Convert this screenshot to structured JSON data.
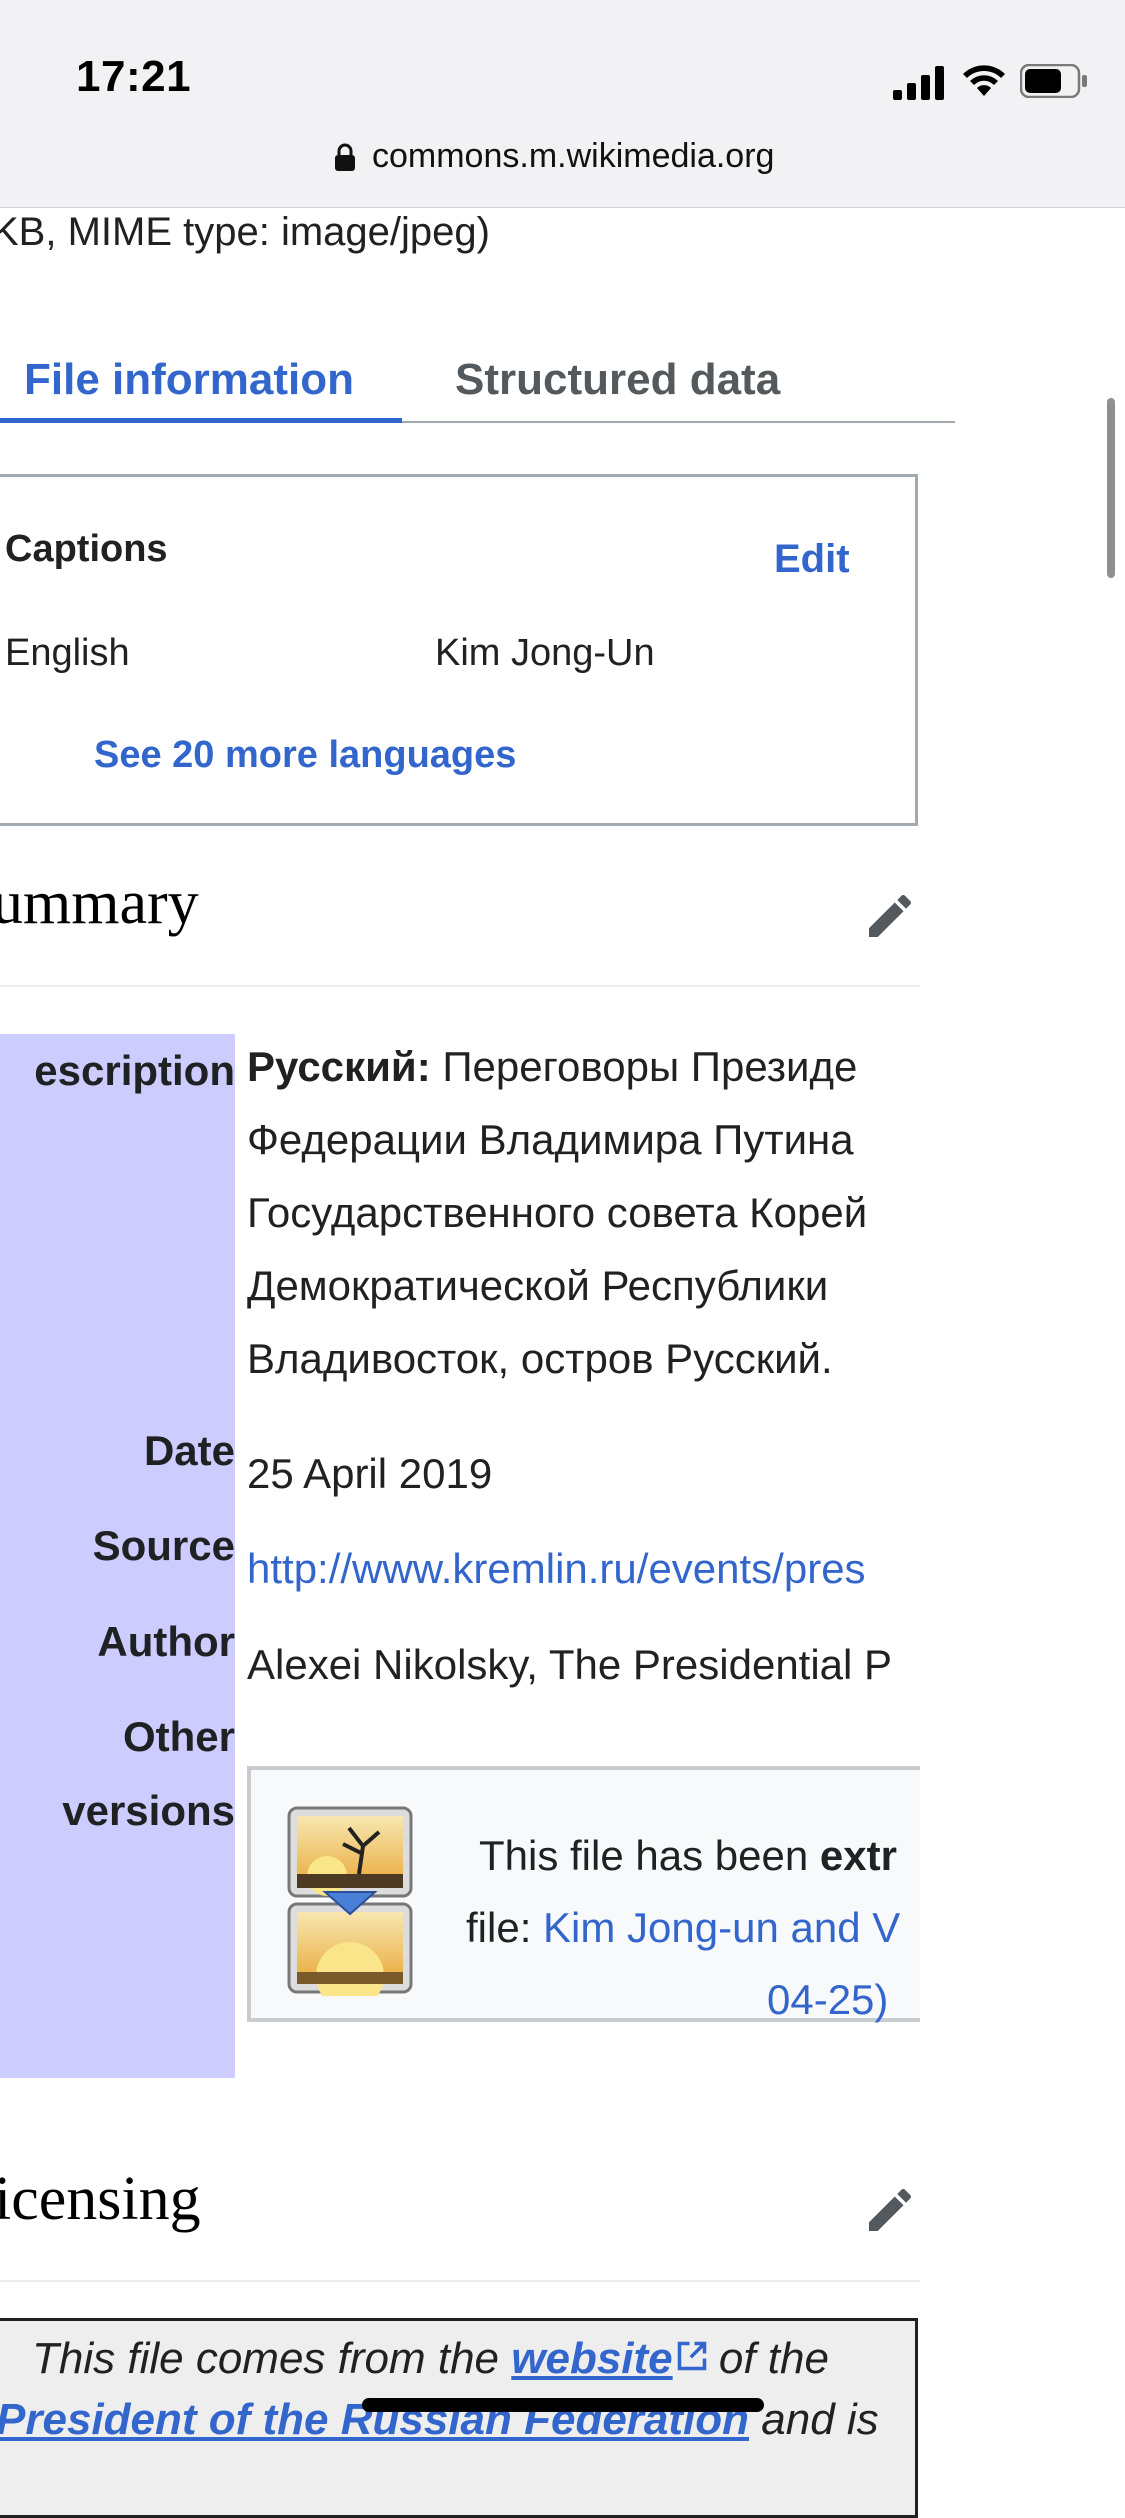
{
  "status_bar": {
    "time": "17:21"
  },
  "browser": {
    "url": "commons.m.wikimedia.org"
  },
  "file_meta_fragment": "KB, MIME type: image/jpeg)",
  "tabs": [
    {
      "label": "File information",
      "active": true
    },
    {
      "label": "Structured data",
      "active": false
    }
  ],
  "captions": {
    "title": "Captions",
    "edit_label": "Edit",
    "language": "English",
    "value": "Kim Jong-Un",
    "more_label": "See 20 more languages"
  },
  "summary": {
    "heading": "ummary",
    "description_label": "escription",
    "description_lang": "Русский:",
    "description_lines": [
      " Переговоры Президе",
      "Федерации Владимира Путина",
      "Государственного совета Корей",
      "Демократической Республики",
      "Владивосток, остров Русский."
    ],
    "date_label": "Date",
    "date_value": "25 April 2019",
    "source_label": "Source",
    "source_value": "http://www.kremlin.ru/events/pres",
    "author_label": "Author",
    "author_value": "Alexei Nikolsky, The Presidential P",
    "other_label_1": "Other",
    "other_label_2": "versions",
    "other_text_1_a": "This file has been ",
    "other_text_1_b": "extr",
    "other_text_2_a": "file: ",
    "other_text_2_b": "Kim Jong-un and V",
    "other_text_3": "04-25)"
  },
  "licensing": {
    "heading": "icensing",
    "text_1_a": "This file comes from the ",
    "text_1_link": "website",
    "text_1_b": " of the",
    "text_2_link": "President of the Russian Federation",
    "text_2_b": " and is"
  },
  "colors": {
    "link": "#3366cc",
    "label_column": "#ccccff",
    "border": "#a2a9b1"
  }
}
